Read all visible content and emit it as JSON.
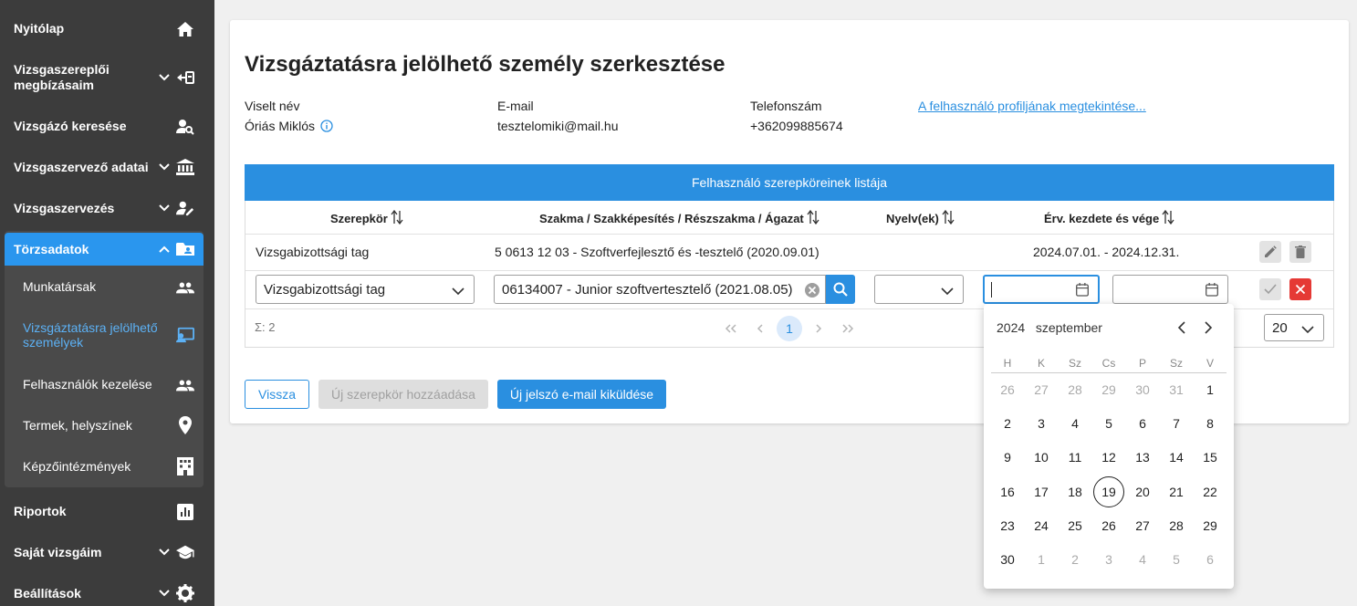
{
  "sidebar": {
    "items": [
      {
        "label": "Nyitólap",
        "icon": "home-icon"
      },
      {
        "label": "Vizsgaszereplői megbízásaim",
        "icon": "assignment-icon"
      },
      {
        "label": "Vizsgázó keresése",
        "icon": "person-search-icon"
      },
      {
        "label": "Vizsgaszervező adatai",
        "icon": "bank-icon"
      },
      {
        "label": "Vizsgaszervezés",
        "icon": "person-edit-icon"
      },
      {
        "label": "Törzsadatok",
        "icon": "folder-person-icon"
      }
    ],
    "sub_items": [
      {
        "label": "Munkatársak",
        "icon": "people-icon"
      },
      {
        "label": "Vizsgáztatásra jelölhető személyek",
        "icon": "presenter-icon"
      },
      {
        "label": "Felhasználók kezelése",
        "icon": "people-icon"
      },
      {
        "label": "Termek, helyszínek",
        "icon": "location-icon"
      },
      {
        "label": "Képzőintézmények",
        "icon": "building-icon"
      }
    ],
    "bottom_items": [
      {
        "label": "Riportok",
        "icon": "report-icon"
      },
      {
        "label": "Saját vizsgáim",
        "icon": "graduation-cap-icon"
      },
      {
        "label": "Beállítások",
        "icon": "gear-icon"
      }
    ]
  },
  "page": {
    "title": "Vizsgáztatásra jelölhető személy szerkesztése",
    "name_label": "Viselt név",
    "name_value": "Óriás Miklós",
    "email_label": "E-mail",
    "email_value": "tesztelomiki@mail.hu",
    "phone_label": "Telefonszám",
    "phone_value": "+362099885674",
    "profile_link": "A felhasználó profiljának megtekintése..."
  },
  "table": {
    "title": "Felhasználó szerepköreinek listája",
    "headers": [
      "Szerepkör",
      "Szakma / Szakképesítés / Részszakma / Ágazat",
      "Nyelv(ek)",
      "Érv. kezdete és vége"
    ],
    "row": {
      "role": "Vizsgabizottsági tag",
      "qualification": "5 0613 12 03 - Szoftverfejlesztő és -tesztelő (2020.09.01)",
      "languages": "",
      "validity": "2024.07.01. - 2024.12.31."
    },
    "edit_row": {
      "role_select": "Vizsgabizottsági tag",
      "qualification_value": "06134007 - Junior szoftvertesztelő (2021.08.05)",
      "language_select": "",
      "start_date": "",
      "end_date": ""
    },
    "total": "Σ: 2",
    "current_page": "1",
    "page_size": "20"
  },
  "buttons": {
    "back": "Vissza",
    "add_role": "Új szerepkör hozzáadása",
    "send_password": "Új jelszó e-mail kiküldése"
  },
  "calendar": {
    "year": "2024",
    "month": "szeptember",
    "weekdays": [
      "H",
      "K",
      "Sz",
      "Cs",
      "P",
      "Sz",
      "V"
    ],
    "weeks": [
      [
        "26",
        "27",
        "28",
        "29",
        "30",
        "31",
        "1"
      ],
      [
        "2",
        "3",
        "4",
        "5",
        "6",
        "7",
        "8"
      ],
      [
        "9",
        "10",
        "11",
        "12",
        "13",
        "14",
        "15"
      ],
      [
        "16",
        "17",
        "18",
        "19",
        "20",
        "21",
        "22"
      ],
      [
        "23",
        "24",
        "25",
        "26",
        "27",
        "28",
        "29"
      ],
      [
        "30",
        "1",
        "2",
        "3",
        "4",
        "5",
        "6"
      ]
    ],
    "today": "19"
  },
  "colors": {
    "sidebar_bg": "#3c3c3c",
    "accent": "#2a8fe0",
    "danger": "#e53935"
  }
}
